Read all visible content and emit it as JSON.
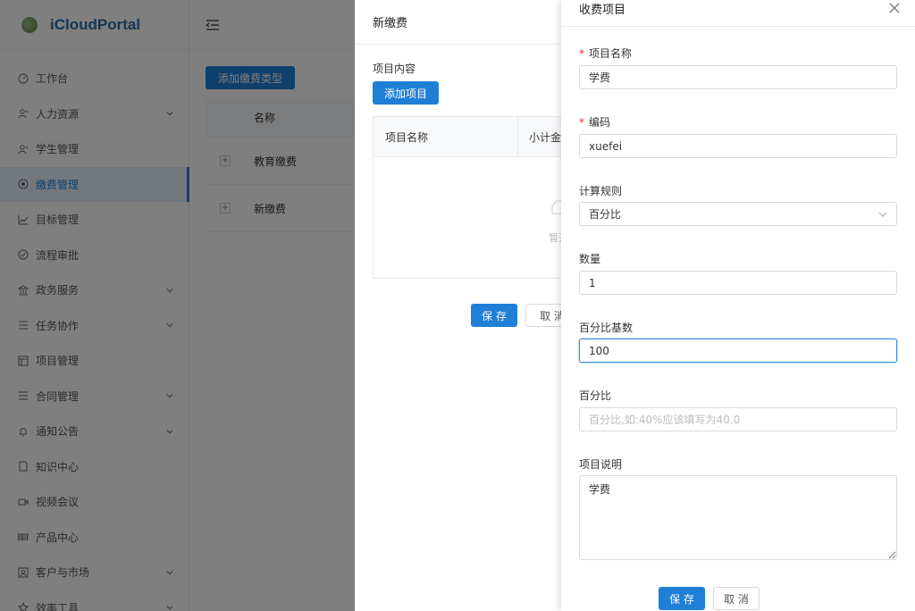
{
  "app": {
    "name": "iCloudPortal"
  },
  "sidebar": {
    "items": [
      {
        "label": "工作台",
        "icon": "dashboard-icon",
        "has_children": false
      },
      {
        "label": "人力资源",
        "icon": "people-icon",
        "has_children": true
      },
      {
        "label": "学生管理",
        "icon": "people-icon",
        "has_children": false
      },
      {
        "label": "缴费管理",
        "icon": "payment-icon",
        "has_children": false,
        "active": true
      },
      {
        "label": "目标管理",
        "icon": "chart-icon",
        "has_children": false
      },
      {
        "label": "流程审批",
        "icon": "check-circle-icon",
        "has_children": false
      },
      {
        "label": "政务服务",
        "icon": "bank-icon",
        "has_children": true
      },
      {
        "label": "任务协作",
        "icon": "list-icon",
        "has_children": true
      },
      {
        "label": "项目管理",
        "icon": "project-icon",
        "has_children": false
      },
      {
        "label": "合同管理",
        "icon": "list-icon",
        "has_children": true
      },
      {
        "label": "通知公告",
        "icon": "bell-icon",
        "has_children": true
      },
      {
        "label": "知识中心",
        "icon": "file-icon",
        "has_children": false
      },
      {
        "label": "视频会议",
        "icon": "video-icon",
        "has_children": false
      },
      {
        "label": "产品中心",
        "icon": "barcode-icon",
        "has_children": false
      },
      {
        "label": "客户与市场",
        "icon": "customer-icon",
        "has_children": true
      },
      {
        "label": "效率工具",
        "icon": "star-icon",
        "has_children": true
      }
    ]
  },
  "main": {
    "add_type_button": "添加缴费类型",
    "table": {
      "header_name": "名称",
      "rows": [
        {
          "name": "教育缴费"
        },
        {
          "name": "新缴费"
        }
      ]
    }
  },
  "drawer_payment": {
    "title": "新缴费",
    "section_label": "项目内容",
    "add_item_button": "添加项目",
    "table_headers": [
      "项目名称",
      "小计金"
    ],
    "empty_text": "暂无",
    "save_button": "保 存",
    "cancel_button": "取 消"
  },
  "drawer_item": {
    "title": "收费项目",
    "fields": {
      "name": {
        "label": "项目名称",
        "required": true,
        "value": "学费"
      },
      "code": {
        "label": "编码",
        "required": true,
        "value": "xuefei"
      },
      "rule": {
        "label": "计算规则",
        "value": "百分比"
      },
      "quantity": {
        "label": "数量",
        "value": "1"
      },
      "base": {
        "label": "百分比基数",
        "value": "100"
      },
      "percent": {
        "label": "百分比",
        "value": "",
        "placeholder": "百分比,如:40%应该填写为40.0"
      },
      "desc": {
        "label": "项目说明",
        "value": "学费"
      }
    },
    "save_button": "保 存",
    "cancel_button": "取 消"
  },
  "colors": {
    "primary": "#1f7fd6",
    "required": "#f5222d",
    "focus": "#3a8ee6"
  }
}
